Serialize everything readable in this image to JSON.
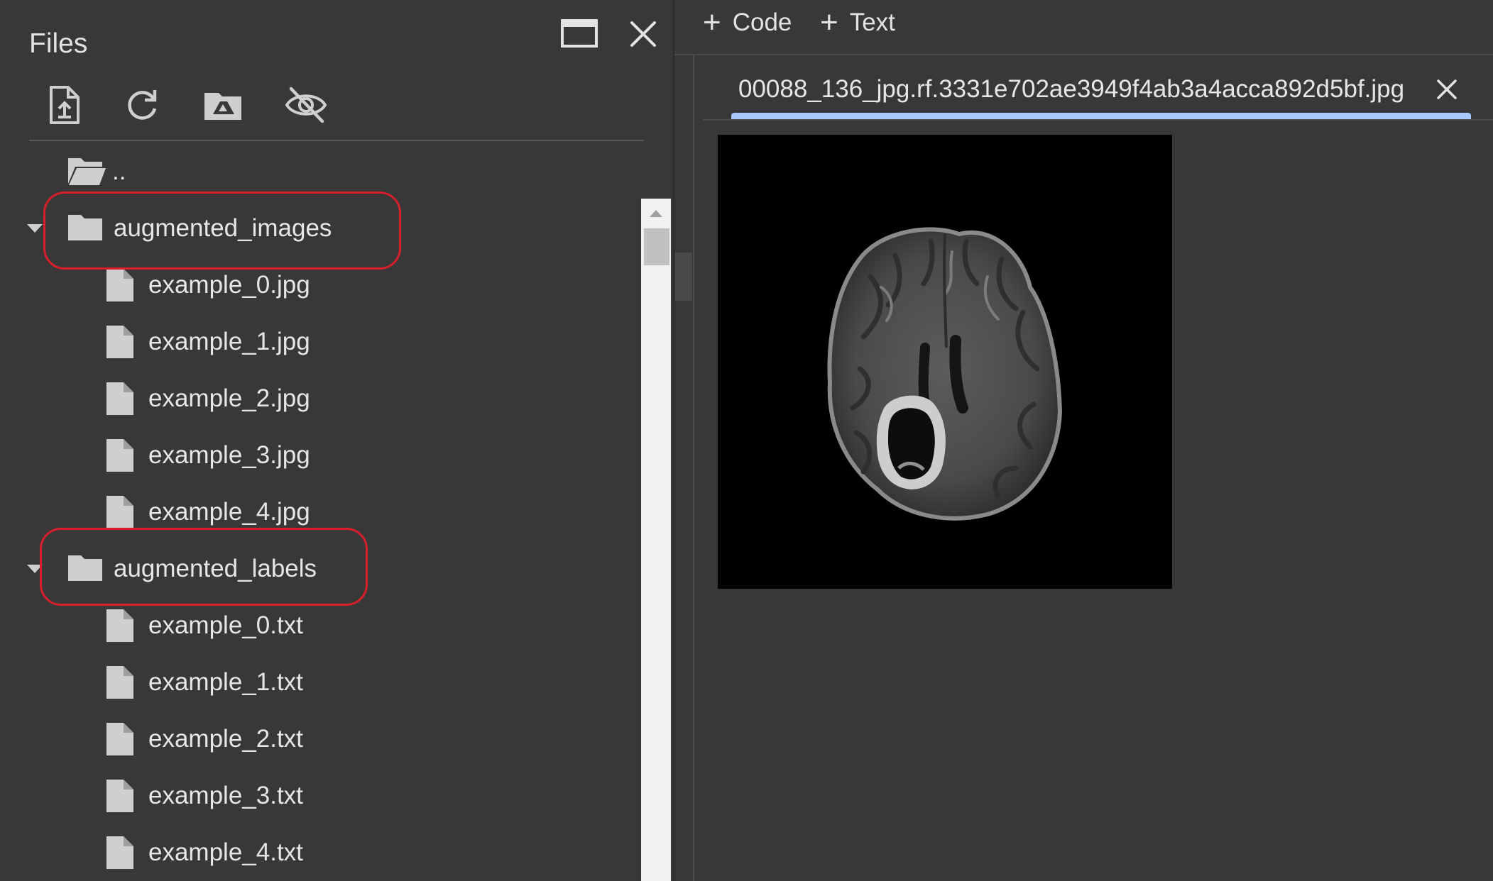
{
  "files_panel": {
    "title": "Files",
    "header_buttons": [
      "open-in-window-icon",
      "close-icon"
    ],
    "toolbar": [
      "upload-file-icon",
      "refresh-icon",
      "mount-drive-icon",
      "hide-hidden-files-icon"
    ],
    "parent_label": "..",
    "tree": [
      {
        "name": "augmented_images",
        "expanded": true,
        "highlighted": true,
        "files": [
          "example_0.jpg",
          "example_1.jpg",
          "example_2.jpg",
          "example_3.jpg",
          "example_4.jpg"
        ]
      },
      {
        "name": "augmented_labels",
        "expanded": true,
        "highlighted": true,
        "files": [
          "example_0.txt",
          "example_1.txt",
          "example_2.txt",
          "example_3.txt",
          "example_4.txt"
        ]
      }
    ]
  },
  "notebook_toolbar": {
    "add_code_label": "Code",
    "add_text_label": "Text"
  },
  "editor_tab": {
    "title": "00088_136_jpg.rf.3331e702ae3949f4ab3a4acca892d5bf.jpg",
    "active": true
  },
  "image_viewer": {
    "content": "brain-mri-scan"
  },
  "colors": {
    "background": "#383838",
    "text": "#e3e3e3",
    "icon": "#cfcfcf",
    "highlight": "#d61f2b",
    "tab_accent": "#a8c7fa",
    "scroll_track": "#f1f1f1",
    "scroll_thumb": "#c1c1c1"
  }
}
